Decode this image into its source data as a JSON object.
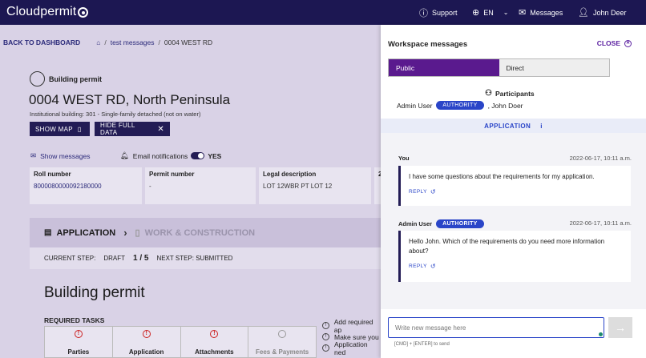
{
  "header": {
    "brand": "Cloudpermit",
    "support": "Support",
    "language": "EN",
    "messages": "Messages",
    "user": "John Deer"
  },
  "breadcrumb": {
    "back": "BACK TO DASHBOARD",
    "separator": "/",
    "item1": "test messages",
    "item2": "0004 WEST RD"
  },
  "permit": {
    "type_label": "Building permit",
    "address": "0004 WEST RD, North Peninsula",
    "subtitle": "Institutional building: 301 - Single-family detached (not on water)",
    "show_map": "SHOW MAP",
    "hide_full_data": "HIDE FULL DATA",
    "show_messages": "Show messages",
    "email_notifications": "Email notifications",
    "email_toggle_state": "YES"
  },
  "info": [
    {
      "label": "Roll number",
      "value": "8000080000092180000"
    },
    {
      "label": "Permit number",
      "value": "-"
    },
    {
      "label": "Legal description",
      "value": "LOT 12WBR PT LOT 12"
    },
    {
      "label": "2",
      "value": ""
    }
  ],
  "steps": {
    "application": "APPLICATION",
    "work": "WORK & CONSTRUCTION",
    "current_step_label": "CURRENT STEP:",
    "current_step_value": "DRAFT",
    "progress": "1 / 5",
    "next_step": "NEXT STEP: SUBMITTED"
  },
  "main": {
    "heading": "Building permit",
    "required_tasks": "REQUIRED TASKS",
    "tasks": [
      "Parties",
      "Application",
      "Attachments",
      "Fees & Payments"
    ],
    "side_tasks": [
      "Add required ap",
      "Make sure you",
      "Application ned"
    ]
  },
  "panel": {
    "title": "Workspace messages",
    "close": "CLOSE",
    "tab_public": "Public",
    "tab_direct": "Direct",
    "participants_title": "Participants",
    "participant1": "Admin User",
    "authority_badge": "AUTHORITY",
    "participant2": ", John Doer",
    "application_strip": "APPLICATION",
    "messages": [
      {
        "author": "You",
        "badge": "",
        "time": "2022-06-17, 10:11 a.m.",
        "text": "I have some questions about the requirements for my application.",
        "reply": "REPLY"
      },
      {
        "author": "Admin User",
        "badge": "AUTHORITY",
        "time": "2022-06-17, 10:11 a.m.",
        "text": "Hello John. Which of the requirements do you need more information about?",
        "reply": "REPLY"
      }
    ],
    "input_placeholder": "Write new message here",
    "hint": "[CMD] + [ENTER] to send"
  }
}
